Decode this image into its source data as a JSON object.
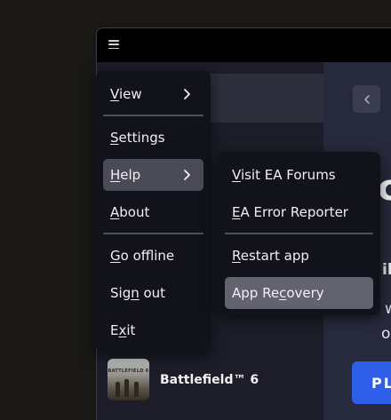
{
  "main_menu": {
    "items": [
      {
        "pre": "",
        "key": "V",
        "post": "iew",
        "has_submenu": true
      },
      {
        "pre": "",
        "key": "S",
        "post": "ettings",
        "has_submenu": false
      },
      {
        "pre": "",
        "key": "H",
        "post": "elp",
        "has_submenu": true
      },
      {
        "pre": "",
        "key": "A",
        "post": "bout",
        "has_submenu": false
      },
      {
        "pre": "",
        "key": "G",
        "post": "o offline",
        "has_submenu": false
      },
      {
        "pre": "Sig",
        "key": "n",
        "post": " out",
        "has_submenu": false
      },
      {
        "pre": "E",
        "key": "x",
        "post": "it",
        "has_submenu": false
      }
    ]
  },
  "help_submenu": {
    "items": [
      {
        "pre": "",
        "key": "V",
        "post": "isit EA Forums"
      },
      {
        "pre": "",
        "key": "E",
        "post": "A Error Reporter"
      },
      {
        "pre": "",
        "key": "R",
        "post": "estart app"
      },
      {
        "pre": "App Re",
        "key": "c",
        "post": "overy"
      }
    ]
  },
  "library": {
    "game_title": "Battlefield™ 6",
    "thumbnail_text": "BATTLEFIELD 6"
  },
  "main": {
    "big_letter": "c",
    "fragments": [
      "ila",
      "w",
      "ou"
    ],
    "play_label": "PL"
  },
  "colors": {
    "menu_bg": "#11121a",
    "menu_active": "#4a4b57",
    "menu_hover": "#62636e",
    "play_button": "#2f5fe8",
    "main_bg": "#272a3c",
    "sidebar_bg": "#1c1d28"
  },
  "icons": {
    "menu": "hamburger-icon",
    "back": "chevron-left-icon",
    "submenu": "chevron-right-icon"
  }
}
